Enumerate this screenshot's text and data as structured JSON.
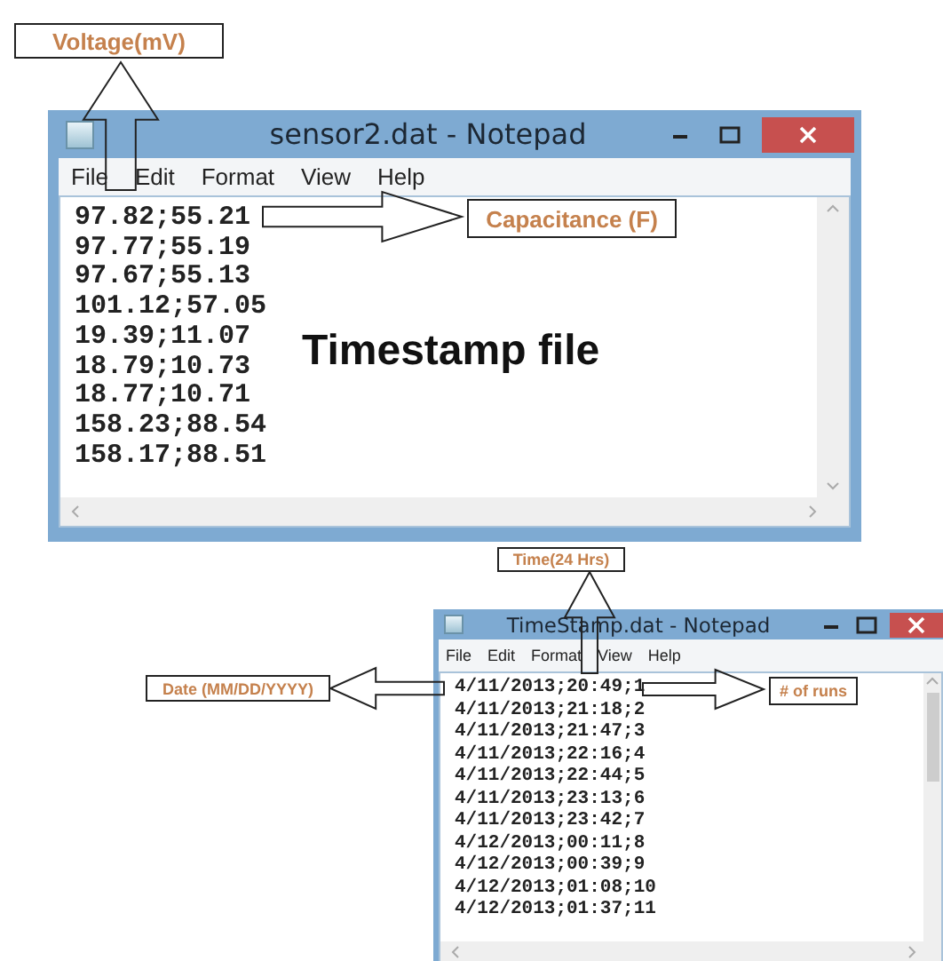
{
  "windows": [
    {
      "title": "sensor2.dat - Notepad",
      "menu": [
        "File",
        "Edit",
        "Format",
        "View",
        "Help"
      ],
      "lines": [
        "97.82;55.21",
        "97.77;55.19",
        "97.67;55.13",
        "101.12;57.05",
        "19.39;11.07",
        "18.79;10.73",
        "18.77;10.71",
        "158.23;88.54",
        "158.17;88.51"
      ]
    },
    {
      "title": "TimeStamp.dat - Notepad",
      "menu": [
        "File",
        "Edit",
        "Format",
        "View",
        "Help"
      ],
      "lines": [
        "4/11/2013;20:49;1",
        "4/11/2013;21:18;2",
        "4/11/2013;21:47;3",
        "4/11/2013;22:16;4",
        "4/11/2013;22:44;5",
        "4/11/2013;23:13;6",
        "4/11/2013;23:42;7",
        "4/12/2013;00:11;8",
        "4/12/2013;00:39;9",
        "4/12/2013;01:08;10",
        "4/12/2013;01:37;11"
      ]
    }
  ],
  "caption": "Timestamp file",
  "callouts": [
    {
      "label": "Voltage(mV)"
    },
    {
      "label": "Capacitance (F)"
    },
    {
      "label": "Time(24 Hrs)"
    },
    {
      "label": "Date (MM/DD/YYYY)"
    },
    {
      "label": "# of runs"
    }
  ]
}
